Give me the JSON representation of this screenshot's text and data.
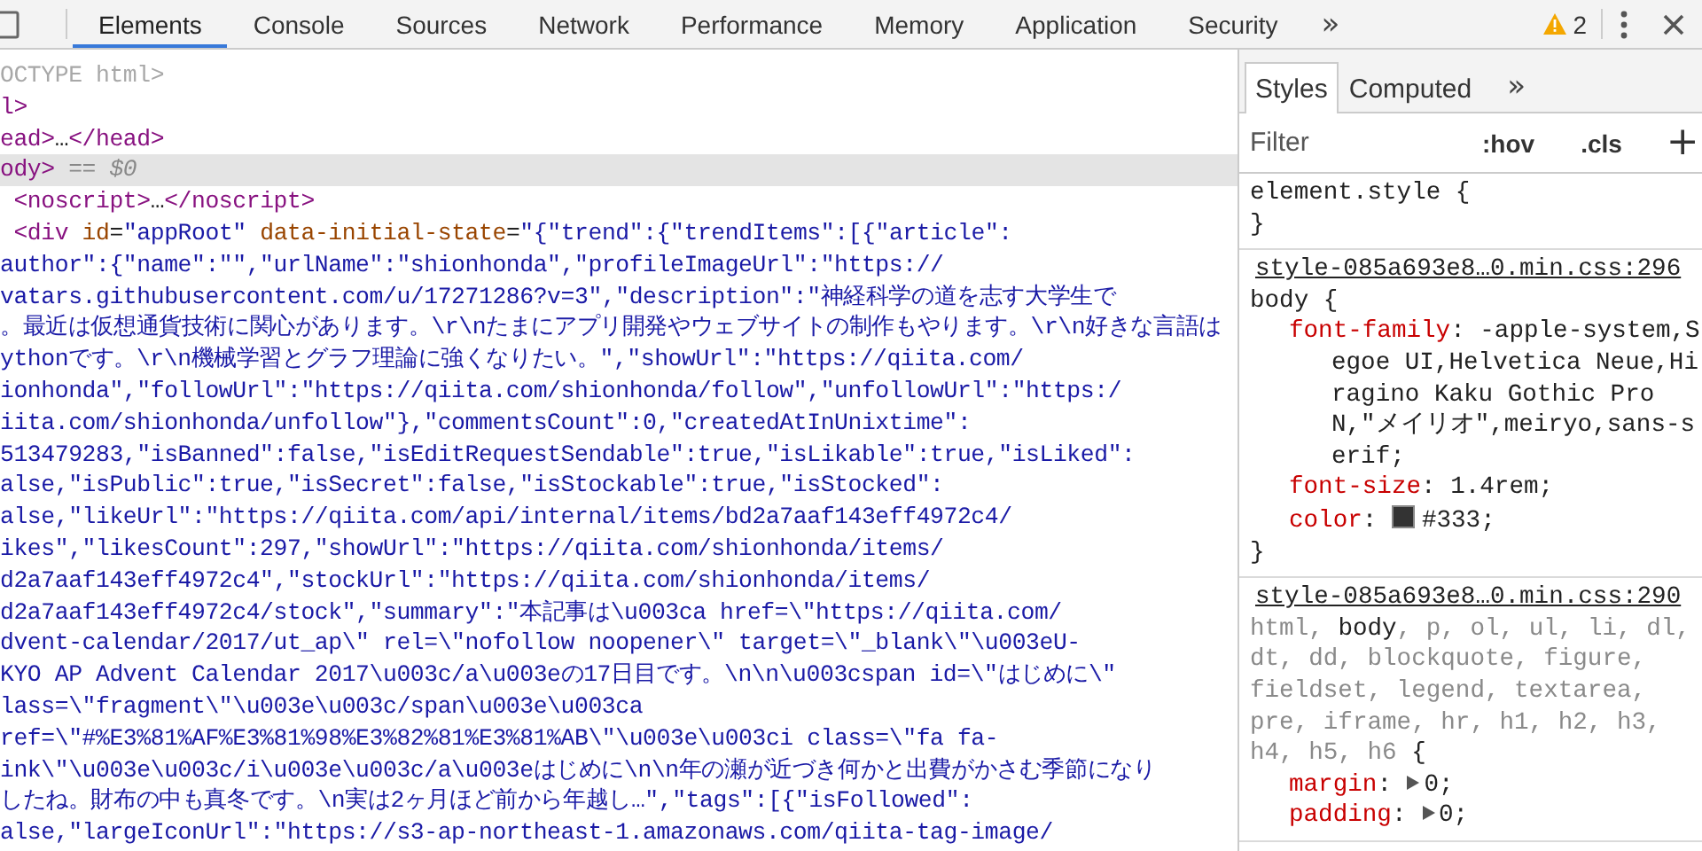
{
  "toolbar": {
    "tabs": [
      {
        "label": "Elements",
        "selected": true
      },
      {
        "label": "Console",
        "selected": false
      },
      {
        "label": "Sources",
        "selected": false
      },
      {
        "label": "Network",
        "selected": false
      },
      {
        "label": "Performance",
        "selected": false
      },
      {
        "label": "Memory",
        "selected": false
      },
      {
        "label": "Application",
        "selected": false
      },
      {
        "label": "Security",
        "selected": false
      }
    ],
    "more": "»",
    "warnings": "2"
  },
  "dom": {
    "lines": [
      {
        "selected": false,
        "segments": [
          {
            "kind": "doctype",
            "text": "OCTYPE html>"
          }
        ]
      },
      {
        "selected": false,
        "segments": [
          {
            "kind": "tag",
            "text": "l>"
          }
        ]
      },
      {
        "selected": false,
        "segments": [
          {
            "kind": "tag",
            "text": "ead>"
          },
          {
            "kind": "text",
            "text": "…"
          },
          {
            "kind": "tag",
            "text": "</head>"
          }
        ]
      },
      {
        "selected": true,
        "segments": [
          {
            "kind": "tag",
            "text": "ody>"
          },
          {
            "kind": "marker",
            "text": " == $0"
          }
        ]
      },
      {
        "selected": false,
        "segments": [
          {
            "kind": "tag",
            "text": " <noscript>"
          },
          {
            "kind": "text",
            "text": "…"
          },
          {
            "kind": "tag",
            "text": "</noscript>"
          }
        ]
      },
      {
        "selected": false,
        "segments": [
          {
            "kind": "tag",
            "text": " <div"
          },
          {
            "kind": "attr",
            "text": " id"
          },
          {
            "kind": "text",
            "text": "="
          },
          {
            "kind": "value",
            "text": "\"appRoot\""
          },
          {
            "kind": "attr",
            "text": " data-initial-state"
          },
          {
            "kind": "text",
            "text": "="
          },
          {
            "kind": "value",
            "text": "\"{\"trend\":{\"trendItems\":[{\"article\":"
          }
        ]
      },
      {
        "selected": false,
        "segments": [
          {
            "kind": "value",
            "text": "author\":{\"name\":\"\",\"urlName\":\"shionhonda\",\"profileImageUrl\":\"https://"
          }
        ]
      },
      {
        "selected": false,
        "segments": [
          {
            "kind": "value",
            "text": "vatars.githubusercontent.com/u/17271286?v=3\",\"description\":\"神経科学の道を志す大学生で"
          }
        ]
      },
      {
        "selected": false,
        "segments": [
          {
            "kind": "value",
            "text": "。最近は仮想通貨技術に関心があります。\\r\\nたまにアプリ開発やウェブサイトの制作もやります。\\r\\n好きな言語は"
          }
        ]
      },
      {
        "selected": false,
        "segments": [
          {
            "kind": "value",
            "text": "ythonです。\\r\\n機械学習とグラフ理論に強くなりたい。\",\"showUrl\":\"https://qiita.com/"
          }
        ]
      },
      {
        "selected": false,
        "segments": [
          {
            "kind": "value",
            "text": "ionhonda\",\"followUrl\":\"https://qiita.com/shionhonda/follow\",\"unfollowUrl\":\"https:/"
          }
        ]
      },
      {
        "selected": false,
        "segments": [
          {
            "kind": "value",
            "text": "iita.com/shionhonda/unfollow\"},\"commentsCount\":0,\"createdAtInUnixtime\":"
          }
        ]
      },
      {
        "selected": false,
        "segments": [
          {
            "kind": "value",
            "text": "513479283,\"isBanned\":false,\"isEditRequestSendable\":true,\"isLikable\":true,\"isLiked\":"
          }
        ]
      },
      {
        "selected": false,
        "segments": [
          {
            "kind": "value",
            "text": "alse,\"isPublic\":true,\"isSecret\":false,\"isStockable\":true,\"isStocked\":"
          }
        ]
      },
      {
        "selected": false,
        "segments": [
          {
            "kind": "value",
            "text": "alse,\"likeUrl\":\"https://qiita.com/api/internal/items/bd2a7aaf143eff4972c4/"
          }
        ]
      },
      {
        "selected": false,
        "segments": [
          {
            "kind": "value",
            "text": "ikes\",\"likesCount\":297,\"showUrl\":\"https://qiita.com/shionhonda/items/"
          }
        ]
      },
      {
        "selected": false,
        "segments": [
          {
            "kind": "value",
            "text": "d2a7aaf143eff4972c4\",\"stockUrl\":\"https://qiita.com/shionhonda/items/"
          }
        ]
      },
      {
        "selected": false,
        "segments": [
          {
            "kind": "value",
            "text": "d2a7aaf143eff4972c4/stock\",\"summary\":\"本記事は\\u003ca href=\\\"https://qiita.com/"
          }
        ]
      },
      {
        "selected": false,
        "segments": [
          {
            "kind": "value",
            "text": "dvent-calendar/2017/ut_ap\\\" rel=\\\"nofollow noopener\\\" target=\\\"_blank\\\"\\u003eU-"
          }
        ]
      },
      {
        "selected": false,
        "segments": [
          {
            "kind": "value",
            "text": "KYO AP Advent Calendar 2017\\u003c/a\\u003eの17日目です。\\n\\n\\u003cspan id=\\\"はじめに\\\""
          }
        ]
      },
      {
        "selected": false,
        "segments": [
          {
            "kind": "value",
            "text": "lass=\\\"fragment\\\"\\u003e\\u003c/span\\u003e\\u003ca"
          }
        ]
      },
      {
        "selected": false,
        "segments": [
          {
            "kind": "value",
            "text": "ref=\\\"#%E3%81%AF%E3%81%98%E3%82%81%E3%81%AB\\\"\\u003e\\u003ci class=\\\"fa fa-"
          }
        ]
      },
      {
        "selected": false,
        "segments": [
          {
            "kind": "value",
            "text": "ink\\\"\\u003e\\u003c/i\\u003e\\u003c/a\\u003eはじめに\\n\\n年の瀬が近づき何かと出費がかさむ季節になり"
          }
        ]
      },
      {
        "selected": false,
        "segments": [
          {
            "kind": "value",
            "text": "したね。財布の中も真冬です。\\n実は2ヶ月ほど前から年越し…\",\"tags\":[{\"isFollowed\":"
          }
        ]
      },
      {
        "selected": false,
        "segments": [
          {
            "kind": "value",
            "text": "alse,\"largeIconUrl\":\"https://s3-ap-northeast-1.amazonaws.com/qiita-tag-image/"
          }
        ]
      }
    ]
  },
  "styles": {
    "tabs": [
      {
        "label": "Styles",
        "selected": true
      },
      {
        "label": "Computed",
        "selected": false
      }
    ],
    "more": "»",
    "filter": {
      "placeholder": "Filter"
    },
    "hov": ":hov",
    "cls": ".cls",
    "add": "+",
    "rules": [
      {
        "selectors": [
          {
            "text": "element.style ",
            "matched": true
          }
        ],
        "open": "{",
        "close": "}"
      },
      {
        "source": "style-085a693e8…0.min.css:296",
        "selectors": [
          {
            "text": "body ",
            "matched": true
          }
        ],
        "open": "{",
        "close": "}",
        "declarations": [
          {
            "name": "font-family",
            "sep": ":",
            "value": "-apple-system,Segoe UI,Helvetica Neue,Hiragino Kaku Gothic ProN,\"メイリオ\",meiryo,sans-serif;",
            "swatch": false,
            "expandable": false
          },
          {
            "name": "font-size",
            "sep": ":",
            "value": "1.4rem;",
            "swatch": false,
            "expandable": false
          },
          {
            "name": "color",
            "sep": ":",
            "value": "#333;",
            "swatch": true,
            "expandable": false
          }
        ]
      },
      {
        "source": "style-085a693e8…0.min.css:290",
        "selectors": [
          {
            "text": "html, ",
            "matched": false
          },
          {
            "text": "body",
            "matched": true
          },
          {
            "text": ", p, ol, ul, li, dl, dt, dd, blockquote, figure, fieldset, legend, textarea, pre, iframe, hr, h1, h2, h3, h4, h5, h6 ",
            "matched": false
          }
        ],
        "open": "{",
        "declarations": [
          {
            "name": "margin",
            "sep": ":",
            "value": "0;",
            "swatch": false,
            "expandable": true
          },
          {
            "name": "padding",
            "sep": ":",
            "value": "0;",
            "swatch": false,
            "expandable": true
          }
        ]
      }
    ]
  }
}
